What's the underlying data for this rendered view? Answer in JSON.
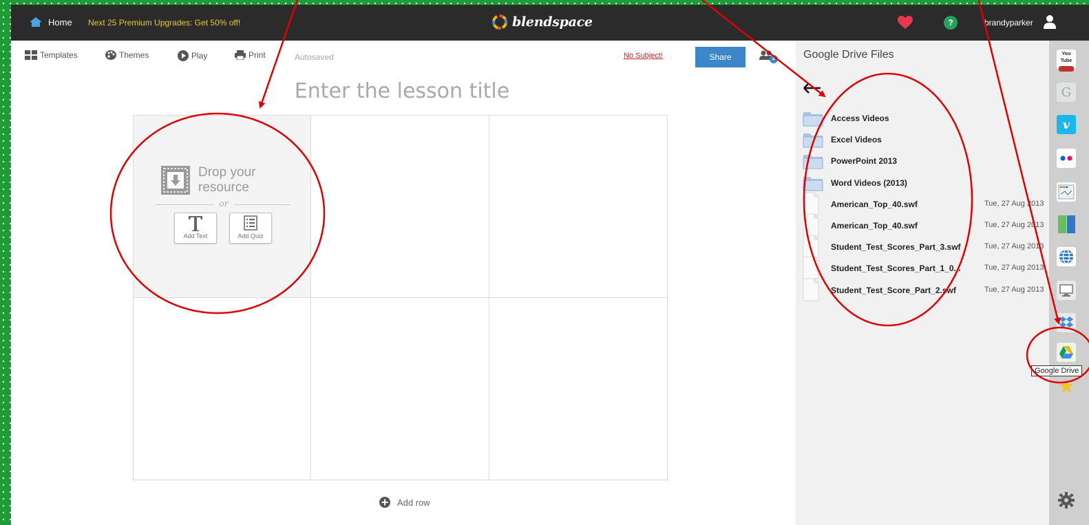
{
  "topbar": {
    "home_label": "Home",
    "promo": "Next 25 Premium Upgrades: Get 50% off!",
    "logo": "blendspace",
    "help": "?",
    "username": "brandyparker"
  },
  "toolbar": {
    "templates": "Templates",
    "themes": "Themes",
    "play": "Play",
    "print": "Print",
    "autosaved": "Autosaved",
    "no_subject": "No Subject!",
    "share": "Share",
    "collab_count": "1"
  },
  "lesson": {
    "title_placeholder": "Enter the lesson title",
    "drop_line1": "Drop your",
    "drop_line2": "resource",
    "or": "or",
    "add_text": "Add Text",
    "add_quiz": "Add Quiz",
    "add_row": "Add row"
  },
  "drive": {
    "title": "Google Drive Files",
    "back": "⇜",
    "items": [
      {
        "type": "folder",
        "name": "Access Videos",
        "date": ""
      },
      {
        "type": "folder",
        "name": "Excel Videos",
        "date": ""
      },
      {
        "type": "folder",
        "name": "PowerPoint 2013",
        "date": ""
      },
      {
        "type": "folder",
        "name": "Word Videos (2013)",
        "date": ""
      },
      {
        "type": "file",
        "name": "American_Top_40.swf",
        "date": "Tue, 27 Aug 2013"
      },
      {
        "type": "file",
        "name": "American_Top_40.swf",
        "date": "Tue, 27 Aug 2013"
      },
      {
        "type": "file",
        "name": "Student_Test_Scores_Part_3.swf",
        "date": "Tue, 27 Aug 2013"
      },
      {
        "type": "file",
        "name": "Student_Test_Scores_Part_1_0...",
        "date": "Tue, 27 Aug 2013"
      },
      {
        "type": "file",
        "name": "Student_Test_Score_Part_2.swf",
        "date": "Tue, 27 Aug 2013"
      }
    ]
  },
  "dock": {
    "youtube": "You Tube",
    "google": "G",
    "vimeo": "v",
    "tooltip": "Google Drive"
  },
  "colors": {
    "frame_green": "#1f9b38",
    "topbar": "#2b2b2b",
    "promo": "#e6c72e",
    "share": "#3c87c9",
    "annotation_red": "#e00000"
  }
}
